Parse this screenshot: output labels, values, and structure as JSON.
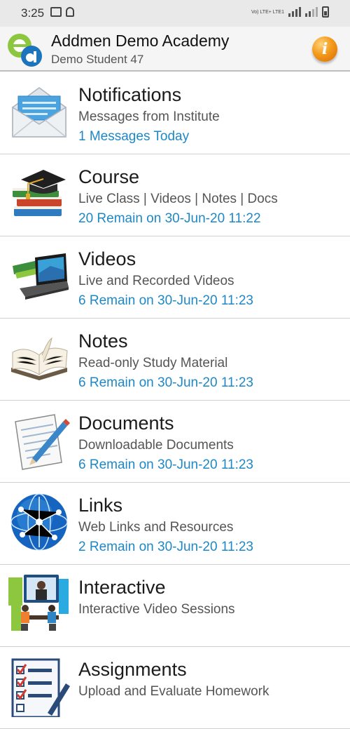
{
  "status_bar": {
    "time": "3:25",
    "network": "Vo) LTE+ LTE1"
  },
  "header": {
    "title": "Addmen Demo Academy",
    "subtitle": "Demo Student 47",
    "info_icon": "info-icon",
    "info_glyph": "i"
  },
  "menu": {
    "items": [
      {
        "title": "Notifications",
        "description": "Messages from Institute",
        "status": "1 Messages Today",
        "icon": "envelope-icon"
      },
      {
        "title": "Course",
        "description": "Live Class | Videos | Notes | Docs",
        "status": "20 Remain on 30-Jun-20 11:22",
        "icon": "graduation-books-icon"
      },
      {
        "title": "Videos",
        "description": "Live and Recorded Videos",
        "status": "6 Remain on 30-Jun-20 11:23",
        "icon": "laptop-books-icon"
      },
      {
        "title": "Notes",
        "description": "Read-only Study Material",
        "status": "6 Remain on 30-Jun-20 11:23",
        "icon": "open-book-icon"
      },
      {
        "title": "Documents",
        "description": "Downloadable Documents",
        "status": "6 Remain on 30-Jun-20 11:23",
        "icon": "document-pen-icon"
      },
      {
        "title": "Links",
        "description": "Web Links and Resources",
        "status": "2 Remain on 30-Jun-20 11:23",
        "icon": "globe-network-icon"
      },
      {
        "title": "Interactive",
        "description": "Interactive Video Sessions",
        "status": "",
        "icon": "video-conference-icon"
      },
      {
        "title": "Assignments",
        "description": "Upload and Evaluate Homework",
        "status": "",
        "icon": "checklist-pen-icon"
      }
    ]
  },
  "colors": {
    "status_link": "#1e88c7",
    "info_orange": "#f39a1a",
    "logo_green": "#8dc63f",
    "logo_blue": "#1c75bc"
  }
}
